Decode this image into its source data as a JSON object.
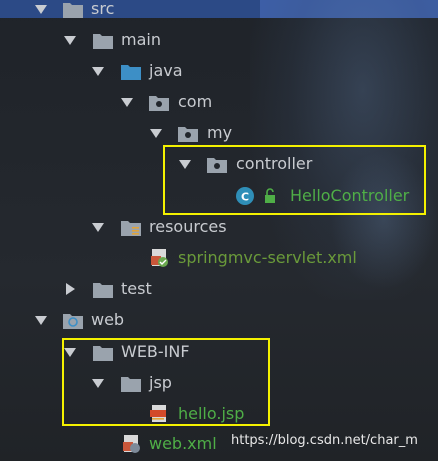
{
  "tree": {
    "src": "src",
    "main": "main",
    "java": "java",
    "com": "com",
    "my": "my",
    "controller": "controller",
    "hello_controller": "HelloController",
    "resources": "resources",
    "springmvc_servlet": "springmvc-servlet.xml",
    "test": "test",
    "web": "web",
    "web_inf": "WEB-INF",
    "jsp": "jsp",
    "hello_jsp": "hello.jsp",
    "web_xml": "web.xml"
  },
  "watermark": "https://blog.csdn.net/char_m",
  "colors": {
    "highlight": "#f4f100",
    "label": "#c8cbd0",
    "file_green": "#6a9a3a",
    "java_folder": "#3d8fc6"
  },
  "icons": [
    "folder-icon",
    "source-folder-icon",
    "package-icon",
    "resources-folder-icon",
    "web-folder-icon",
    "class-icon",
    "lock-icon",
    "xml-file-icon",
    "jsp-file-icon"
  ]
}
